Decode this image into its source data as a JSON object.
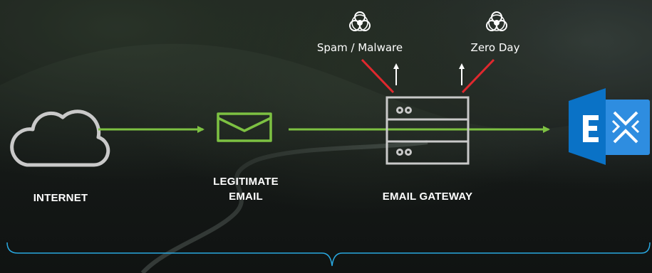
{
  "nodes": {
    "internet": "INTERNET",
    "email_line1": "LEGITIMATE",
    "email_line2": "EMAIL",
    "gateway": "EMAIL GATEWAY"
  },
  "threats": {
    "spam": "Spam / Malware",
    "zero_day": "Zero Day"
  },
  "colors": {
    "flow_arrow": "#7dc142",
    "threat_arrow": "#e0282e",
    "outline": "#c9c9c9",
    "exchange_blue": "#0a72c6",
    "bracket": "#29a8e0"
  },
  "icons": [
    "cloud-icon",
    "envelope-icon",
    "server-icon",
    "biohazard-icon",
    "exchange-icon"
  ]
}
